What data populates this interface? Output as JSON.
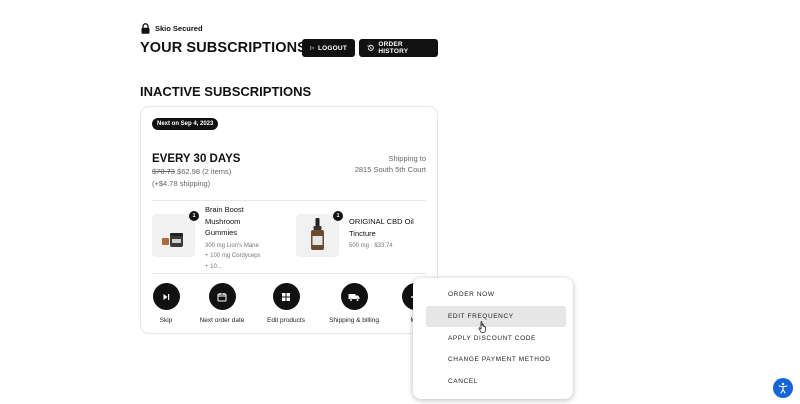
{
  "header": {
    "secured_label": "Skio Secured",
    "title": "YOUR SUBSCRIPTIONS",
    "logout_label": "LOGOUT",
    "order_history_label": "ORDER HISTORY"
  },
  "section": {
    "title": "INACTIVE SUBSCRIPTIONS"
  },
  "subscription": {
    "badge": "Next on Sep 4, 2023",
    "frequency": "EVERY 30 DAYS",
    "original_price": "$78.73",
    "price": "$62.98",
    "item_count": "(2 items)",
    "shipping_cost": "(+$4.78 shipping)",
    "shipping_to_label": "Shipping to",
    "shipping_address": "2815 South 5th Court",
    "products": [
      {
        "name": "Brain Boost Mushroom Gummies",
        "description": "300 mg Lion's Mane + 100 mg Cordyceps + 10...",
        "quantity": "1"
      },
      {
        "name": "ORIGINAL CBD Oil Tincture",
        "description": "500 mg  ·  $33.74",
        "quantity": "1"
      }
    ],
    "actions": [
      {
        "label": "Skip",
        "icon": "skip-icon"
      },
      {
        "label": "Next order date",
        "icon": "calendar-icon"
      },
      {
        "label": "Edit products",
        "icon": "grid-icon"
      },
      {
        "label": "Shipping & billing",
        "icon": "truck-icon"
      },
      {
        "label": "Mo",
        "icon": "more-icon"
      }
    ]
  },
  "menu": {
    "items": [
      {
        "label": "ORDER NOW"
      },
      {
        "label": "EDIT FREQUENCY"
      },
      {
        "label": "APPLY DISCOUNT CODE"
      },
      {
        "label": "CHANGE PAYMENT METHOD"
      },
      {
        "label": "CANCEL"
      }
    ],
    "hovered_item": "EDIT FREQUENCY"
  },
  "accessibility": {
    "icon": "accessibility-icon",
    "color": "#1565d8"
  }
}
